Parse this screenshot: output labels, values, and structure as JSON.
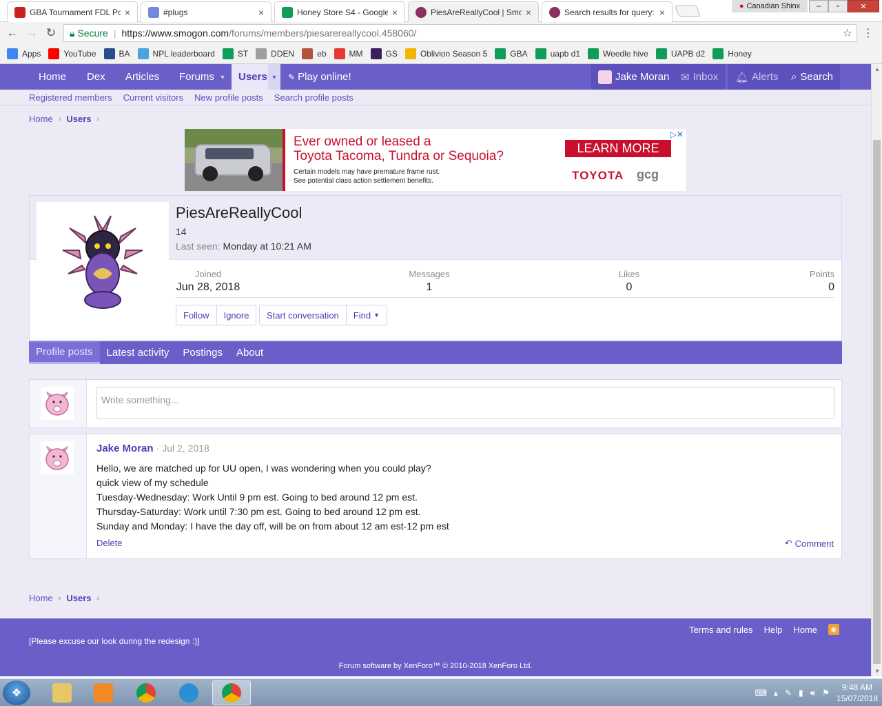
{
  "browser": {
    "tabs": [
      {
        "title": "GBA Tournament FDL Po",
        "favicon_color": "#cc2020",
        "active": false
      },
      {
        "title": "#plugs",
        "favicon_color": "#7289da",
        "active": false
      },
      {
        "title": "Honey Store S4 - Google",
        "favicon_color": "#0f9d58",
        "active": false
      },
      {
        "title": "PiesAreReallyCool | Smog",
        "favicon_color": "#8a2f5f",
        "active": true
      },
      {
        "title": "Search results for query:",
        "favicon_color": "#8a2f5f",
        "active": false
      }
    ],
    "tab_close_glyph": "×",
    "profile_name": "Canadian Shinx",
    "window_buttons": {
      "minimize": "–",
      "maximize": "▫",
      "close": "✕"
    },
    "address": {
      "secure_label": "Secure",
      "url_scheme_host": "https://www.smogon.com",
      "url_path": "/forums/members/piesarereallycool.458060/"
    },
    "bookmarks": [
      {
        "label": "Apps",
        "icon": "apps-grid-icon",
        "color": "#4285f4"
      },
      {
        "label": "YouTube",
        "icon": "youtube-icon",
        "color": "#ff0000"
      },
      {
        "label": "BA",
        "icon": "smogon-icon",
        "color": "#2a4c8a"
      },
      {
        "label": "NPL leaderboard",
        "icon": "face-icon",
        "color": "#4aa3df"
      },
      {
        "label": "ST",
        "icon": "sheets-icon",
        "color": "#0f9d58"
      },
      {
        "label": "DDEN",
        "icon": "document-icon",
        "color": "#9e9e9e"
      },
      {
        "label": "eb",
        "icon": "pokemon-icon",
        "color": "#b5523b"
      },
      {
        "label": "MM",
        "icon": "pdf-icon",
        "color": "#e53935"
      },
      {
        "label": "GS",
        "icon": "game-icon",
        "color": "#3a1f5a"
      },
      {
        "label": "Oblivion Season 5",
        "icon": "drive-icon",
        "color": "#f4b400"
      },
      {
        "label": "GBA",
        "icon": "sheets-icon",
        "color": "#0f9d58"
      },
      {
        "label": "uapb d1",
        "icon": "sheets-icon",
        "color": "#0f9d58"
      },
      {
        "label": "Weedle hive",
        "icon": "sheets-icon",
        "color": "#0f9d58"
      },
      {
        "label": "UAPB d2",
        "icon": "sheets-icon",
        "color": "#0f9d58"
      },
      {
        "label": "Honey",
        "icon": "sheets-icon",
        "color": "#0f9d58"
      }
    ]
  },
  "site": {
    "accent": "#6a5fc9",
    "nav": {
      "home": "Home",
      "dex": "Dex",
      "articles": "Articles",
      "forums": "Forums",
      "users": "Users",
      "play": "Play online!",
      "user_name": "Jake Moran",
      "inbox": "Inbox",
      "alerts": "Alerts",
      "search": "Search"
    },
    "subnav": [
      "Registered members",
      "Current visitors",
      "New profile posts",
      "Search profile posts"
    ],
    "breadcrumb": {
      "home": "Home",
      "current": "Users"
    },
    "ad": {
      "headline_line1": "Ever owned or leased a",
      "headline_line2": "Toyota Tacoma, Tundra or Sequoia?",
      "sub_line1": "Certain models may have premature frame rust.",
      "sub_line2": "See potential class action settlement benefits.",
      "cta": "LEARN MORE",
      "brand": "TOYOTA",
      "partner": "gcg"
    },
    "profile": {
      "username": "PiesAreReallyCool",
      "title": "14",
      "last_seen_label": "Last seen:",
      "last_seen_value": "Monday at 10:21 AM",
      "stats": {
        "joined_label": "Joined",
        "joined_value": "Jun 28, 2018",
        "messages_label": "Messages",
        "messages_value": "1",
        "likes_label": "Likes",
        "likes_value": "0",
        "points_label": "Points",
        "points_value": "0"
      },
      "buttons": {
        "follow": "Follow",
        "ignore": "Ignore",
        "start_conversation": "Start conversation",
        "find": "Find"
      }
    },
    "profile_tabs": [
      "Profile posts",
      "Latest activity",
      "Postings",
      "About"
    ],
    "composer_placeholder": "Write something...",
    "post": {
      "author": "Jake Moran",
      "date": "· Jul 2, 2018",
      "lines": [
        "Hello, we are matched up for UU open, I was wondering when you could play?",
        "quick view of my schedule",
        "Tuesday-Wednesday: Work Until 9 pm est. Going to bed around 12 pm est.",
        "Thursday-Saturday: Work until 7:30 pm est. Going to bed around 12 pm est.",
        "Sunday and Monday: I have the day off, will be on from about 12 am est-12 pm est"
      ],
      "delete": "Delete",
      "comment": "Comment"
    },
    "footer": {
      "links": [
        "Terms and rules",
        "Help",
        "Home"
      ],
      "note": "[Please excuse our look during the redesign :)]",
      "copyright": "Forum software by XenForo™ © 2010-2018 XenForo Ltd."
    }
  },
  "taskbar": {
    "time": "9:48 AM",
    "date": "15/07/2018"
  }
}
